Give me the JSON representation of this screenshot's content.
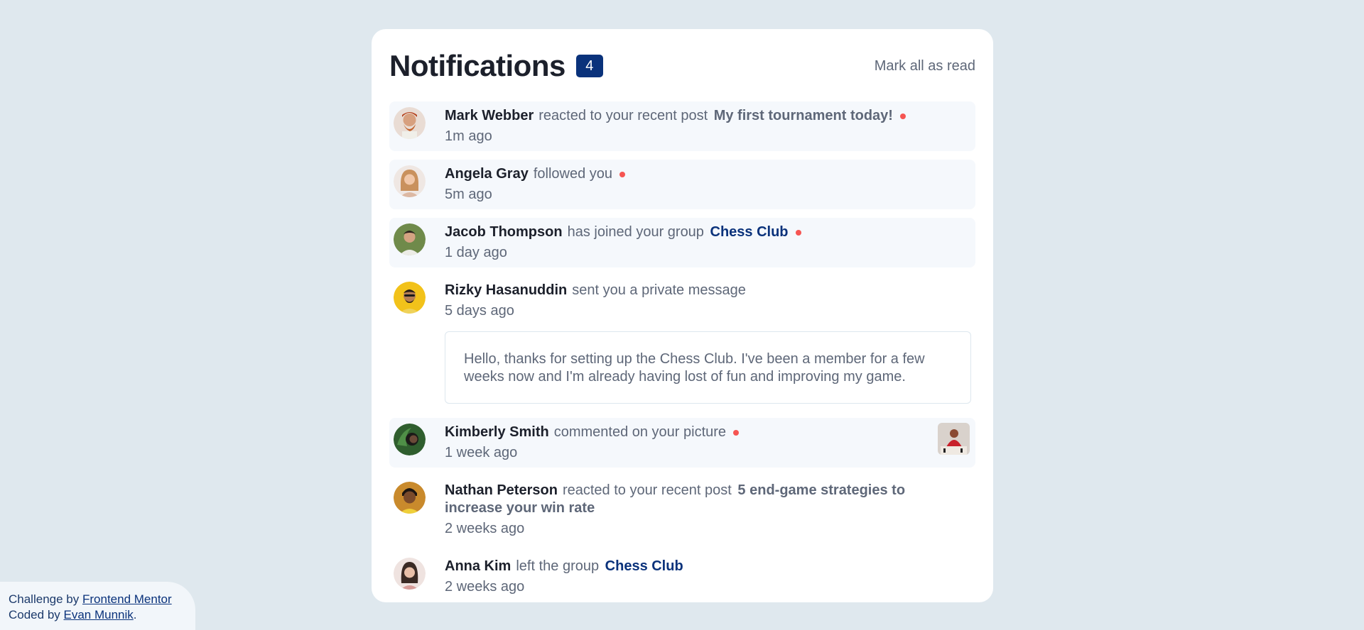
{
  "header": {
    "title": "Notifications",
    "count": "4",
    "mark_all": "Mark all as read"
  },
  "notifications": [
    {
      "name": "Mark Webber",
      "action": "reacted to your recent post",
      "post": "My first tournament today!",
      "time": "1m ago",
      "unread": true,
      "avatar_icon": "avatar-mark-webber"
    },
    {
      "name": "Angela Gray",
      "action": "followed you",
      "time": "5m ago",
      "unread": true,
      "avatar_icon": "avatar-angela-gray"
    },
    {
      "name": "Jacob Thompson",
      "action": "has joined your group",
      "group": "Chess Club",
      "time": "1 day ago",
      "unread": true,
      "avatar_icon": "avatar-jacob-thompson"
    },
    {
      "name": "Rizky Hasanuddin",
      "action": "sent you a private message",
      "time": "5 days ago",
      "unread": false,
      "message": "Hello, thanks for setting up the Chess Club. I've been a member for a few weeks now and I'm already having lost of fun and improving my game.",
      "avatar_icon": "avatar-rizky-hasanuddin"
    },
    {
      "name": "Kimberly Smith",
      "action": "commented on your picture",
      "time": "1 week ago",
      "unread": true,
      "avatar_icon": "avatar-kimberly-smith",
      "thumb_icon": "chess-picture-thumbnail"
    },
    {
      "name": "Nathan Peterson",
      "action": "reacted to your recent post",
      "post": "5 end-game strategies to increase your win rate",
      "time": "2 weeks ago",
      "unread": false,
      "avatar_icon": "avatar-nathan-peterson"
    },
    {
      "name": "Anna Kim",
      "action": "left the group",
      "group": "Chess Club",
      "time": "2 weeks ago",
      "unread": false,
      "avatar_icon": "avatar-anna-kim"
    }
  ],
  "attribution": {
    "challenge_prefix": "Challenge by",
    "challenge_link": "Frontend Mentor",
    "coded_prefix": "Coded by",
    "coded_link": "Evan Munnik",
    "coded_suffix": "."
  },
  "colors": {
    "background": "#dfe8ee",
    "accent_blue": "#0a327b",
    "unread_dot": "#f65552",
    "unread_bg": "#f5f8fc"
  }
}
